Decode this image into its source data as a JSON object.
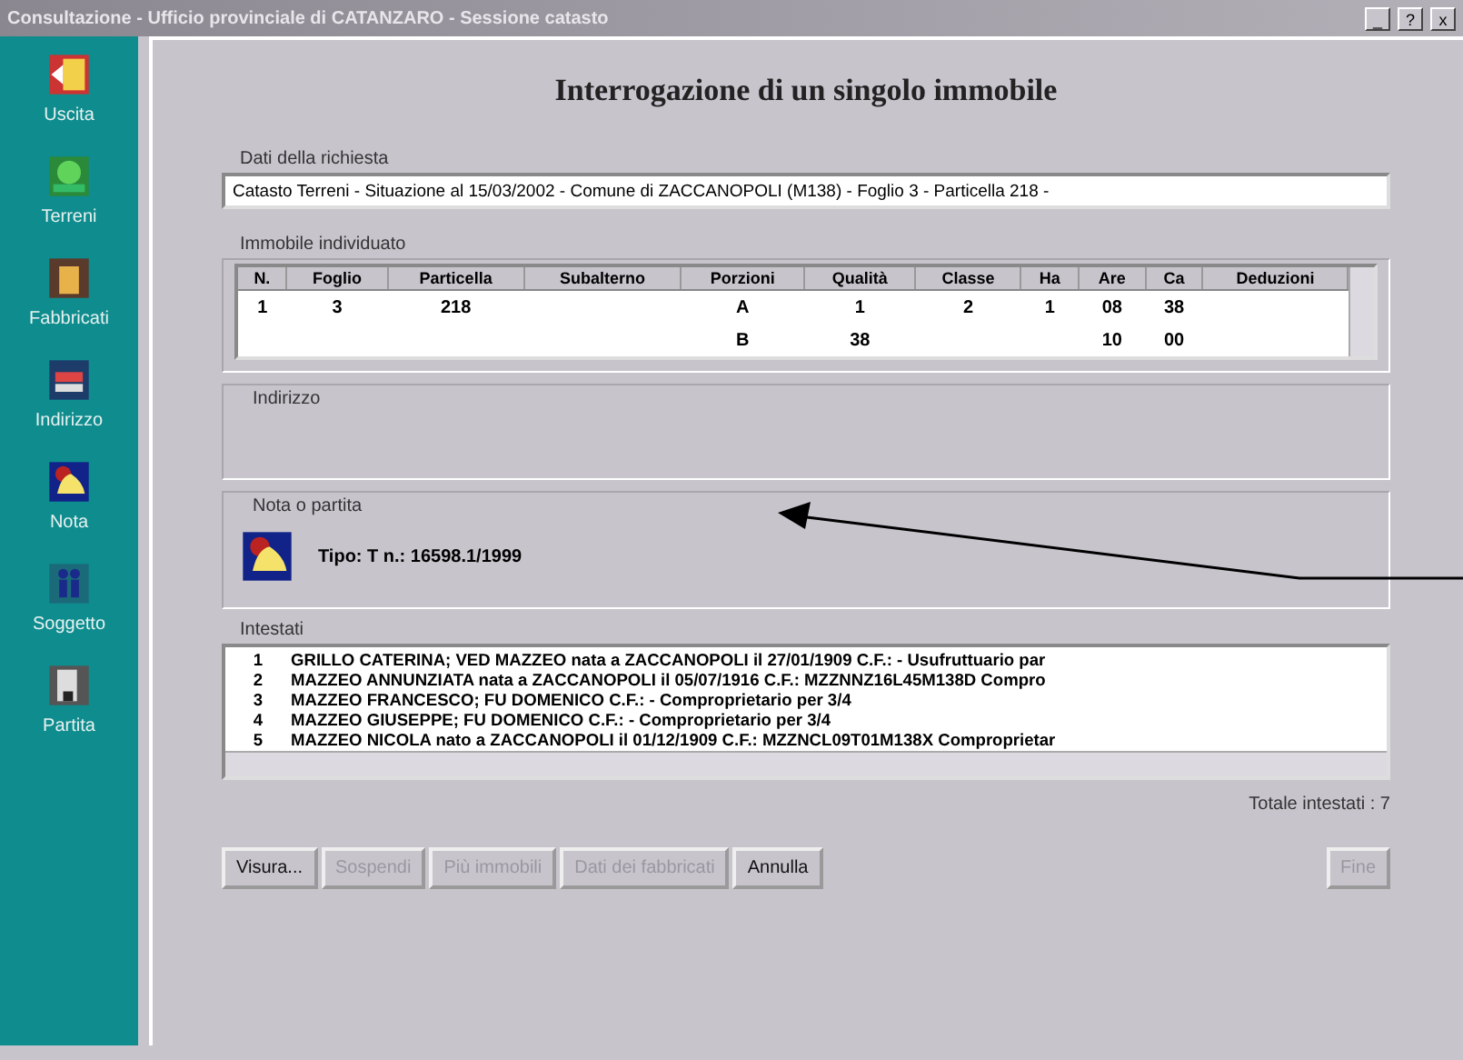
{
  "window": {
    "title": "Consultazione - Ufficio provinciale di CATANZARO - Sessione catasto",
    "controls": [
      "_",
      "?",
      "x"
    ]
  },
  "sidebar": {
    "items": [
      {
        "label": "Uscita",
        "kind": "exit"
      },
      {
        "label": "Terreni",
        "kind": "land"
      },
      {
        "label": "Fabbricati",
        "kind": "building"
      },
      {
        "label": "Indirizzo",
        "kind": "address"
      },
      {
        "label": "Nota",
        "kind": "note"
      },
      {
        "label": "Soggetto",
        "kind": "person"
      },
      {
        "label": "Partita",
        "kind": "ledger"
      }
    ]
  },
  "heading": "Interrogazione di un singolo immobile",
  "request": {
    "label": "Dati della richiesta",
    "value": "Catasto Terreni - Situazione al 15/03/2002 - Comune di ZACCANOPOLI (M138) - Foglio 3 - Particella 218 -"
  },
  "property": {
    "label": "Immobile individuato",
    "columns": [
      "N.",
      "Foglio",
      "Particella",
      "Subalterno",
      "Porzioni",
      "Qualità",
      "Classe",
      "Ha",
      "Are",
      "Ca",
      "Deduzioni"
    ],
    "rows": [
      [
        "1",
        "3",
        "218",
        "",
        "A",
        "1",
        "2",
        "1",
        "08",
        "38",
        ""
      ],
      [
        "",
        "",
        "",
        "",
        "B",
        "38",
        "",
        "",
        "10",
        "00",
        ""
      ]
    ]
  },
  "address": {
    "label": "Indirizzo"
  },
  "note": {
    "label": "Nota o partita",
    "value": "Tipo: T n.: 16598.1/1999"
  },
  "owners": {
    "label": "Intestati",
    "rows": [
      {
        "n": "1",
        "text": "GRILLO CATERINA; VED MAZZEO nata a ZACCANOPOLI il 27/01/1909 C.F.: -  Usufruttuario par"
      },
      {
        "n": "2",
        "text": "MAZZEO ANNUNZIATA nata a ZACCANOPOLI il 05/07/1916 C.F.: MZZNNZ16L45M138D Compro"
      },
      {
        "n": "3",
        "text": "MAZZEO FRANCESCO; FU DOMENICO   C.F.: -  Comproprietario per 3/4"
      },
      {
        "n": "4",
        "text": "MAZZEO GIUSEPPE; FU DOMENICO   C.F.: -  Comproprietario per 3/4"
      },
      {
        "n": "5",
        "text": "MAZZEO NICOLA nato a ZACCANOPOLI il 01/12/1909 C.F.: MZZNCL09T01M138X Comproprietar"
      }
    ],
    "total": "Totale intestati : 7"
  },
  "buttons": [
    {
      "label": "Visura...",
      "disabled": false
    },
    {
      "label": "Sospendi",
      "disabled": true
    },
    {
      "label": "Più immobili",
      "disabled": true
    },
    {
      "label": "Dati dei fabbricati",
      "disabled": true
    },
    {
      "label": "Annulla",
      "disabled": false
    }
  ],
  "close_button": {
    "label": "Fine",
    "disabled": true
  }
}
